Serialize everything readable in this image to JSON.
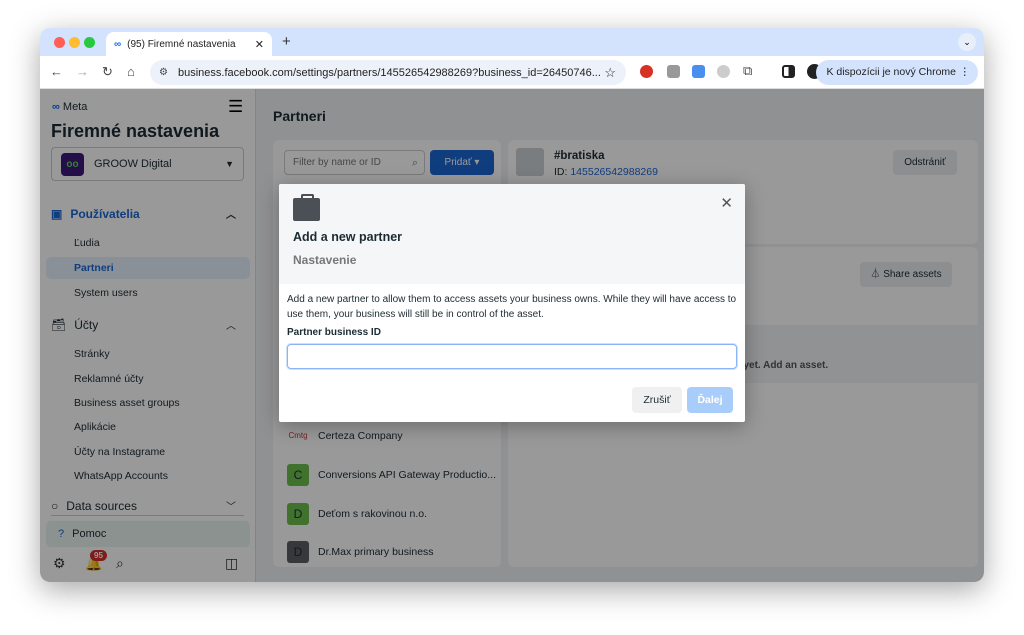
{
  "browser": {
    "tab_title": "(95) Firemné nastavenia",
    "url": "business.facebook.com/settings/partners/145526542988269?business_id=26450746...",
    "chrome_update": "K dispozícii je nový Chrome"
  },
  "sidebar": {
    "brand": "Meta",
    "title": "Firemné nastavenia",
    "business": "GROOW Digital",
    "business_logo": "oo",
    "sections": [
      {
        "label": "Používatelia",
        "items": [
          "Ľudia",
          "Partneri",
          "System users"
        ]
      },
      {
        "label": "Účty",
        "items": [
          "Stránky",
          "Reklamné účty",
          "Business asset groups",
          "Aplikácie",
          "Účty na Instagrame",
          "WhatsApp Accounts"
        ]
      },
      {
        "label": "Data sources"
      }
    ],
    "active_item": "Partneri",
    "help": "Pomoc",
    "notifications": "95"
  },
  "main": {
    "title": "Partneri",
    "filter_placeholder": "Filter by name or ID",
    "add_button": "Pridať",
    "partners": [
      {
        "name": "Certeza Company",
        "logo": "Cmtg",
        "color": "#ffffff"
      },
      {
        "name": "Conversions API Gateway Productio...",
        "initial": "C",
        "color": "#6bbf4e"
      },
      {
        "name": "Deťom s rakovinou n.o.",
        "initial": "D",
        "color": "#6bbf4e"
      },
      {
        "name": "Dr.Max primary business",
        "initial": "D",
        "color": "#5b5e63"
      }
    ],
    "detail": {
      "name": "#bratiska",
      "id_label": "ID:",
      "id": "145526542988269",
      "remove": "Odstrániť",
      "share_assets": "Share assets",
      "empty": "No assets shared yet. Add an asset."
    }
  },
  "modal": {
    "title": "Add a new partner",
    "subtitle": "Nastavenie",
    "description": "Add a new partner to allow them to access assets your business owns. While they will have access to use them, your business will still be in control of the asset.",
    "field_label": "Partner business ID",
    "field_value": "",
    "cancel": "Zrušiť",
    "next": "Ďalej"
  },
  "colors": {
    "accent": "#1a66d2",
    "tabbar": "#d3e3fd"
  }
}
